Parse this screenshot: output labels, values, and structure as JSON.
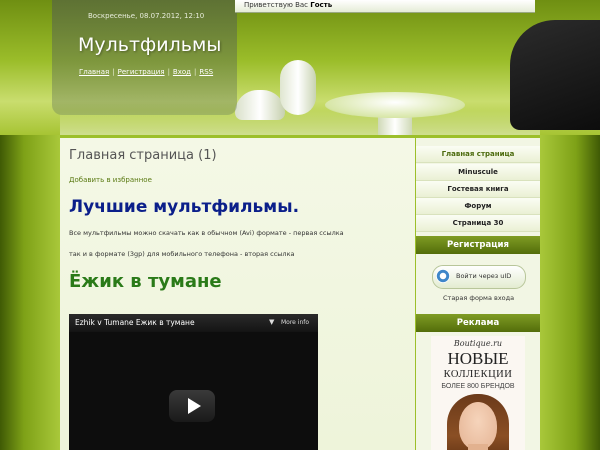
{
  "header": {
    "date": "Воскресенье, 08.07.2012, 12:10",
    "greeting_prefix": "Приветствую Вас",
    "greeting_user": "Гость",
    "site_title": "Мультфильмы",
    "nav": [
      "Главная",
      "Регистрация",
      "Вход",
      "RSS"
    ]
  },
  "content": {
    "page_heading": "Главная страница (1)",
    "favorites_link": "Добавить в избранное",
    "heading_best": "Лучшие мультфильмы.",
    "paragraph1": "Все мультфильмы можно скачать как в обычном (Avi) формате - первая ссылка",
    "paragraph2": "так и в формате (3gp) для мобильного телефона - вторая ссылка",
    "heading_movie": "Ёжик в тумане",
    "video": {
      "title": "Ezhik v Tumane Ежик в тумане",
      "more_info": "More info"
    }
  },
  "sidebar": {
    "menu": [
      "Главная страница",
      "Minuscule",
      "Гостевая книга",
      "Форум",
      "Страница 30"
    ],
    "registration": {
      "title": "Регистрация",
      "uid_button": "Войти через uID",
      "old_form": "Старая форма входа"
    },
    "ad": {
      "title": "Реклама",
      "brand": "Boutique.ru",
      "headline1": "НОВЫЕ",
      "headline2": "КОЛЛЕКЦИИ",
      "headline3": "БОЛЕЕ 800 БРЕНДОВ"
    }
  },
  "colors": {
    "background": "#9cbf2a",
    "heading_blue": "#0b1f8a",
    "heading_green": "#2a7a18",
    "sidebar_header": "#536d0a"
  },
  "icons": [
    "play-icon",
    "uid-icon",
    "more-info-icon"
  ]
}
